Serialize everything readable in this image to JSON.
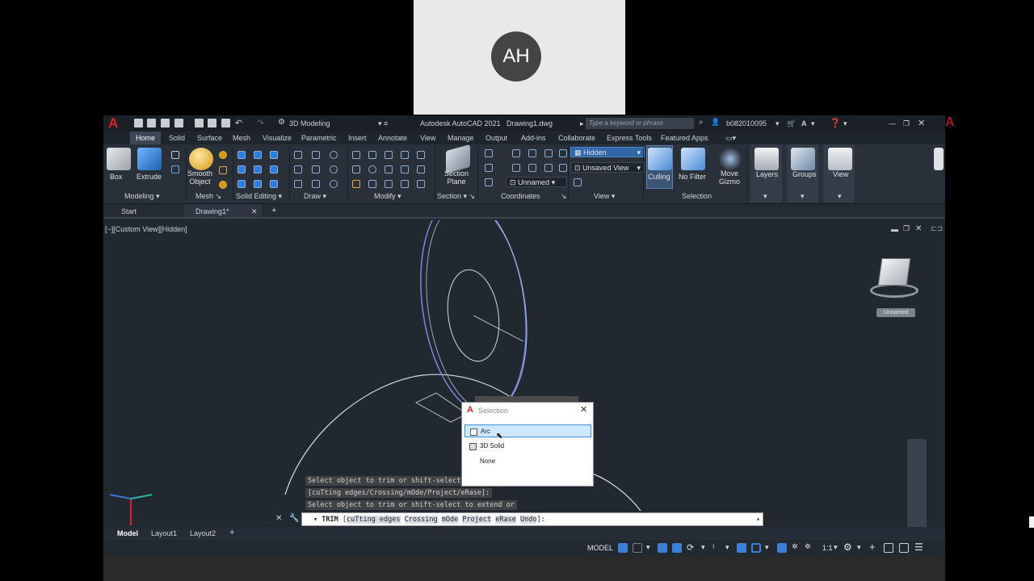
{
  "participant": {
    "initials": "AH"
  },
  "app": {
    "title": "Autodesk AutoCAD 2021",
    "document": "Drawing1.dwg",
    "workspace": "3D Modeling",
    "search_placeholder": "Type a keyword or phrase",
    "user": "b082010095"
  },
  "menu_tabs": [
    "Home",
    "Solid",
    "Surface",
    "Mesh",
    "Visualize",
    "Parametric",
    "Insert",
    "Annotate",
    "View",
    "Manage",
    "Output",
    "Add-ins",
    "Collaborate",
    "Express Tools",
    "Featured Apps"
  ],
  "ribbon": {
    "box": "Box",
    "extrude": "Extrude",
    "smooth_object": "Smooth\nObject",
    "section_plane": "Section\nPlane",
    "culling": "Culling",
    "no_filter": "No Filter",
    "move_gizmo": "Move\nGizmo",
    "layers": "Layers",
    "groups": "Groups",
    "view": "View",
    "visual_style": "Hidden",
    "named_view": "Unsaved View",
    "ucs_name": "Unnamed",
    "panels": {
      "modeling": "Modeling",
      "mesh": "Mesh",
      "solid_editing": "Solid Editing",
      "draw": "Draw",
      "modify": "Modify",
      "section": "Section",
      "coordinates": "Coordinates",
      "view": "View",
      "selection": "Selection"
    }
  },
  "doc_tabs": {
    "start": "Start",
    "drawing": "Drawing1*"
  },
  "viewport_label": "[−][Custom View][Hidden]",
  "viewcube_label": "Unnamed",
  "selection_dialog": {
    "title": "Selection",
    "items": [
      "Arc",
      "3D Solid",
      "None"
    ],
    "selected": "Arc"
  },
  "command_history": [
    "Select object to trim or shift-select",
    " [cuTting edges/Crossing/mOde/Project/eRase]:",
    "Select object to trim or shift-select to extend or"
  ],
  "command_line": {
    "command": "TRIM",
    "prompt_prefix": "[",
    "options": [
      "cuTting edges",
      "Crossing",
      "mOde",
      "Project",
      "eRase",
      "Undo"
    ],
    "prompt_suffix": "]:"
  },
  "layout_tabs": [
    "Model",
    "Layout1",
    "Layout2"
  ],
  "status": {
    "space": "MODEL",
    "scale": "1:1"
  },
  "colors": {
    "accent": "#1f6fc5",
    "drawing_blue": "#7f8fe6",
    "drawing_white": "#d6dbe2",
    "autocad_red": "#e0202a"
  }
}
